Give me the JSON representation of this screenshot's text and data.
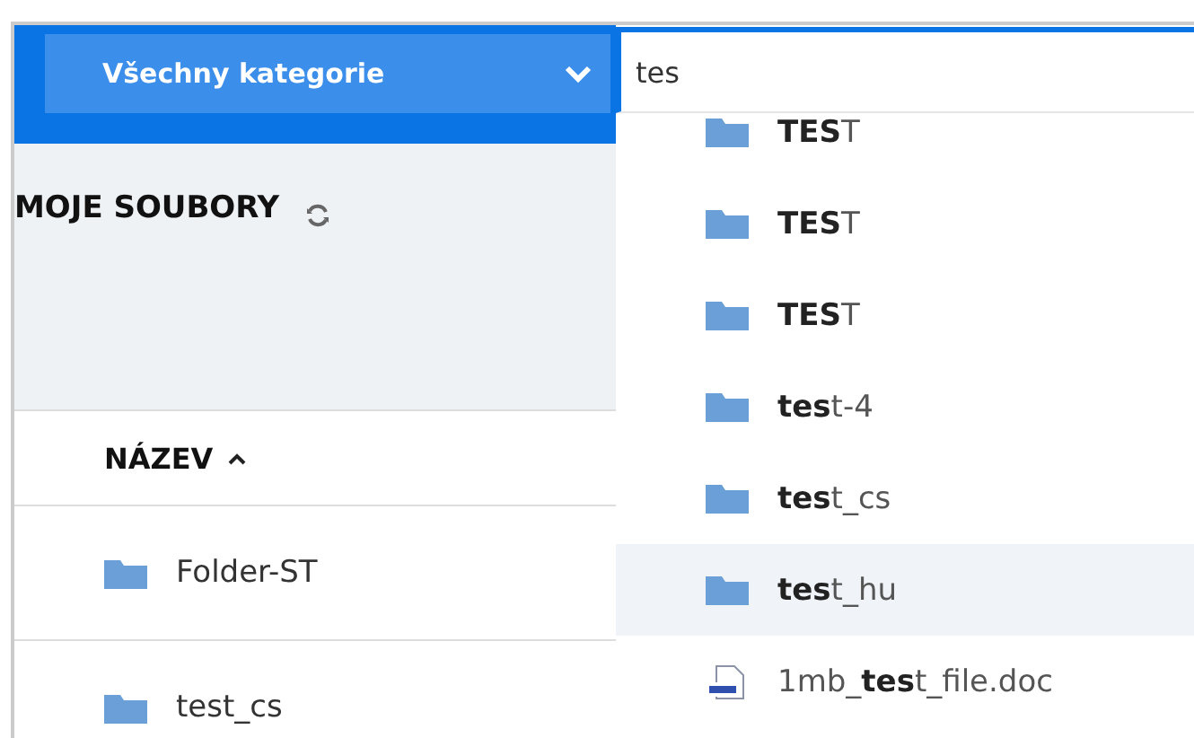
{
  "category_dropdown": {
    "label": "Všechny kategorie"
  },
  "search": {
    "value": "tes"
  },
  "results": [
    {
      "kind": "folder",
      "name": "**TES**T",
      "selected": false
    },
    {
      "kind": "folder",
      "name": "**TES**T",
      "selected": false
    },
    {
      "kind": "folder",
      "name": "**TES**T",
      "selected": false
    },
    {
      "kind": "folder",
      "name": "**tes**t-4",
      "selected": false
    },
    {
      "kind": "folder",
      "name": "**tes**t_cs",
      "selected": false
    },
    {
      "kind": "folder",
      "name": "**tes**t_hu",
      "selected": true
    },
    {
      "kind": "doc",
      "name": "1mb_**tes**t_file.doc",
      "selected": false
    }
  ],
  "page": {
    "title": "MOJE SOUBORY"
  },
  "table": {
    "column_header": "NÁZEV",
    "rows": [
      {
        "name": "Folder-ST"
      },
      {
        "name": "test_cs"
      }
    ]
  }
}
